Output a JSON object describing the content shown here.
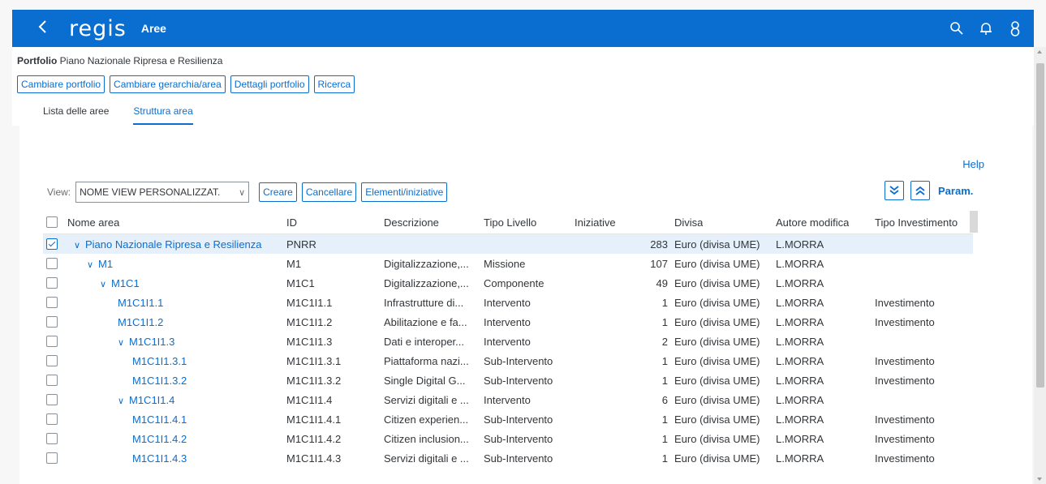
{
  "shell": {
    "logo": "regis",
    "title": "Aree"
  },
  "portfolio": {
    "label": "Portfolio",
    "value": "Piano Nazionale Ripresa e Resilienza"
  },
  "actions": [
    "Cambiare portfolio",
    "Cambiare gerarchia/area",
    "Dettagli portfolio",
    "Ricerca"
  ],
  "tabs": [
    {
      "label": "Lista delle aree",
      "active": false
    },
    {
      "label": "Struttura area",
      "active": true
    }
  ],
  "help": "Help",
  "toolbar": {
    "view_label": "View:",
    "view_value": "NOME VIEW PERSONALIZZAT.",
    "create": "Creare",
    "delete": "Cancellare",
    "elements": "Elementi/iniziative",
    "param": "Param."
  },
  "columns": [
    "Nome area",
    "ID",
    "Descrizione",
    "Tipo Livello",
    "Iniziative",
    "Divisa",
    "Autore modifica",
    "Tipo Investimento"
  ],
  "rows": [
    {
      "name": "Piano Nazionale Ripresa e Resilienza",
      "level": 0,
      "expanded": true,
      "checked": true,
      "id": "PNRR",
      "desc": "",
      "tipo": "",
      "iniz": "283",
      "divisa": "Euro (divisa UME)",
      "autore": "L.MORRA",
      "inv": ""
    },
    {
      "name": "M1",
      "level": 1,
      "expanded": true,
      "checked": false,
      "id": "M1",
      "desc": "Digitalizzazione,...",
      "tipo": "Missione",
      "iniz": "107",
      "divisa": "Euro (divisa UME)",
      "autore": "L.MORRA",
      "inv": ""
    },
    {
      "name": "M1C1",
      "level": 2,
      "expanded": true,
      "checked": false,
      "id": "M1C1",
      "desc": "Digitalizzazione,...",
      "tipo": "Componente",
      "iniz": "49",
      "divisa": "Euro (divisa UME)",
      "autore": "L.MORRA",
      "inv": ""
    },
    {
      "name": "M1C1I1.1",
      "level": 3,
      "expanded": null,
      "checked": false,
      "id": "M1C1I1.1",
      "desc": "Infrastrutture di...",
      "tipo": "Intervento",
      "iniz": "1",
      "divisa": "Euro (divisa UME)",
      "autore": "L.MORRA",
      "inv": "Investimento"
    },
    {
      "name": "M1C1I1.2",
      "level": 3,
      "expanded": null,
      "checked": false,
      "id": "M1C1I1.2",
      "desc": "Abilitazione e fa...",
      "tipo": "Intervento",
      "iniz": "1",
      "divisa": "Euro (divisa UME)",
      "autore": "L.MORRA",
      "inv": "Investimento"
    },
    {
      "name": "M1C1I1.3",
      "level": 3,
      "expanded": true,
      "checked": false,
      "id": "M1C1I1.3",
      "desc": "Dati e interoper...",
      "tipo": "Intervento",
      "iniz": "2",
      "divisa": "Euro (divisa UME)",
      "autore": "L.MORRA",
      "inv": ""
    },
    {
      "name": "M1C1I1.3.1",
      "level": 4,
      "expanded": null,
      "checked": false,
      "id": "M1C1I1.3.1",
      "desc": "Piattaforma nazi...",
      "tipo": "Sub-Intervento",
      "iniz": "1",
      "divisa": "Euro (divisa UME)",
      "autore": "L.MORRA",
      "inv": "Investimento"
    },
    {
      "name": "M1C1I1.3.2",
      "level": 4,
      "expanded": null,
      "checked": false,
      "id": "M1C1I1.3.2",
      "desc": " Single Digital G...",
      "tipo": "Sub-Intervento",
      "iniz": "1",
      "divisa": "Euro (divisa UME)",
      "autore": "L.MORRA",
      "inv": "Investimento"
    },
    {
      "name": "M1C1I1.4",
      "level": 3,
      "expanded": true,
      "checked": false,
      "id": "M1C1I1.4",
      "desc": "Servizi digitali e ...",
      "tipo": "Intervento",
      "iniz": "6",
      "divisa": "Euro (divisa UME)",
      "autore": "L.MORRA",
      "inv": ""
    },
    {
      "name": "M1C1I1.4.1",
      "level": 4,
      "expanded": null,
      "checked": false,
      "id": "M1C1I1.4.1",
      "desc": "Citizen experien...",
      "tipo": "Sub-Intervento",
      "iniz": "1",
      "divisa": "Euro (divisa UME)",
      "autore": "L.MORRA",
      "inv": "Investimento"
    },
    {
      "name": "M1C1I1.4.2",
      "level": 4,
      "expanded": null,
      "checked": false,
      "id": "M1C1I1.4.2",
      "desc": "Citizen inclusion...",
      "tipo": "Sub-Intervento",
      "iniz": "1",
      "divisa": "Euro (divisa UME)",
      "autore": "L.MORRA",
      "inv": "Investimento"
    },
    {
      "name": "M1C1I1.4.3",
      "level": 4,
      "expanded": null,
      "checked": false,
      "id": "M1C1I1.4.3",
      "desc": "Servizi digitali e ...",
      "tipo": "Sub-Intervento",
      "iniz": "1",
      "divisa": "Euro (divisa UME)",
      "autore": "L.MORRA",
      "inv": "Investimento"
    }
  ],
  "colors": {
    "shell": "#0a6ed1",
    "link": "#0a6ed1",
    "selected_row": "#e5f0fa"
  },
  "icons": {
    "back": "chevron-left-icon",
    "search": "search-icon",
    "notifications": "bell-icon",
    "user": "user-icon",
    "expand_all": "double-chevron-down-icon",
    "collapse_all": "double-chevron-up-icon"
  }
}
